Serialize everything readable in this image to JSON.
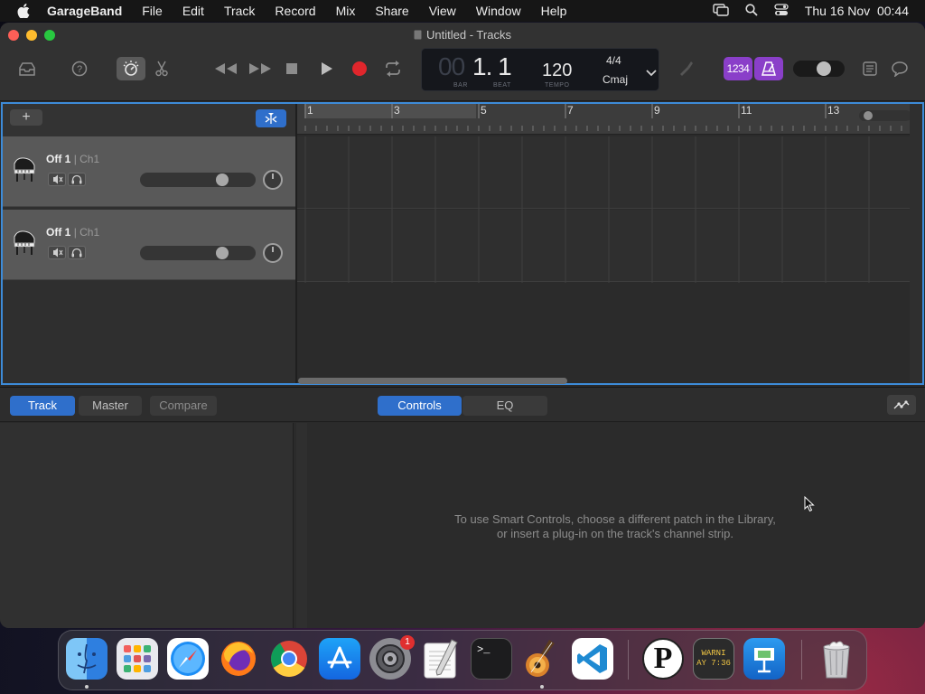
{
  "menubar": {
    "apple_icon": "apple-icon",
    "items": [
      "GarageBand",
      "File",
      "Edit",
      "Track",
      "Record",
      "Mix",
      "Share",
      "View",
      "Window",
      "Help"
    ],
    "status_icons": [
      "screen-mirroring-icon",
      "search-icon",
      "control-center-icon"
    ],
    "clock": "Thu 16 Nov  00:44"
  },
  "window": {
    "title": "Untitled - Tracks",
    "traffic_lights": {
      "close": "#fe5f57",
      "minimize": "#febc2e",
      "zoom": "#28c840"
    }
  },
  "toolbar": {
    "icons": [
      "library-icon",
      "help-icon",
      "smart-controls-icon",
      "scissors-icon",
      "rewind-icon",
      "fast-forward-icon",
      "stop-icon",
      "play-icon",
      "record-icon",
      "cycle-icon",
      "tuner-icon",
      "count-in-icon",
      "metronome-icon",
      "master-volume-slider",
      "notepad-icon",
      "loops-icon"
    ],
    "count_in_label": "1234",
    "record_color": "#e0262c",
    "accent": "#8a3fc9"
  },
  "lcd": {
    "bar_dim": "00",
    "bar_beat": "1. 1",
    "bar_label": "BAR",
    "beat_label": "BEAT",
    "tempo": "120",
    "tempo_label": "TEMPO",
    "signature": "4/4",
    "key": "Cmaj"
  },
  "tracks_header": {
    "add_label": "+"
  },
  "ruler": {
    "bars": [
      "1",
      "3",
      "5",
      "7",
      "9",
      "11",
      "13"
    ]
  },
  "tracks": [
    {
      "name": "Off 1",
      "channel": "| Ch1",
      "instrument_icon": "piano-icon",
      "volume": 0.75
    },
    {
      "name": "Off 1",
      "channel": "| Ch1",
      "instrument_icon": "piano-icon",
      "volume": 0.75
    }
  ],
  "lower": {
    "tabs_left": [
      "Track",
      "Master",
      "Compare"
    ],
    "active_left": "Track",
    "tabs_center": [
      "Controls",
      "EQ"
    ],
    "active_center": "Controls",
    "hint_line1": "To use Smart Controls, choose a different patch in the Library,",
    "hint_line2": "or insert a plug-in on the track's channel strip."
  },
  "dock": {
    "apps": [
      "Finder",
      "Launchpad",
      "Safari",
      "Firefox",
      "Chrome",
      "App Store",
      "System Settings",
      "TextEdit",
      "Terminal",
      "GarageBand",
      "Visual Studio Code",
      "P",
      "Console",
      "Keynote",
      "Trash"
    ],
    "settings_badge": "1",
    "console_text_1": "WARNI",
    "console_text_2": "AY 7:36",
    "p_letter": "P"
  }
}
